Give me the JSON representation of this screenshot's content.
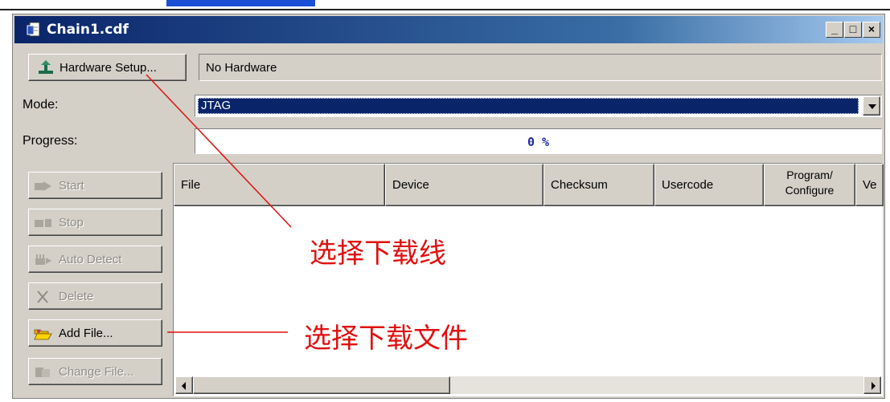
{
  "window": {
    "title": "Chain1.cdf",
    "controls": [
      "_",
      "□",
      "×"
    ]
  },
  "hardware": {
    "setup_label": "Hardware Setup...",
    "status": "No Hardware"
  },
  "mode": {
    "label": "Mode:",
    "value": "JTAG"
  },
  "progress": {
    "label": "Progress:",
    "value": "0 %",
    "fraction": 0
  },
  "sidebar": {
    "buttons": [
      {
        "label": "Start",
        "icon": "start-icon",
        "enabled": false
      },
      {
        "label": "Stop",
        "icon": "stop-icon",
        "enabled": false
      },
      {
        "label": "Auto Detect",
        "icon": "auto-detect-icon",
        "enabled": false
      },
      {
        "label": "Delete",
        "icon": "delete-x-icon",
        "enabled": false
      },
      {
        "label": "Add File...",
        "icon": "folder-open-icon",
        "enabled": true
      },
      {
        "label": "Change File...",
        "icon": "change-file-icon",
        "enabled": false
      }
    ]
  },
  "table": {
    "columns": [
      "File",
      "Device",
      "Checksum",
      "Usercode",
      "Program/\nConfigure",
      "Ve"
    ],
    "rows": []
  },
  "annotations": {
    "hardware_note": "选择下载线",
    "file_note": "选择下载文件"
  },
  "colors": {
    "titlebar": "#0a246a",
    "selection": "#0a246a",
    "annotation": "#e01010",
    "face": "#d4d0c8"
  }
}
